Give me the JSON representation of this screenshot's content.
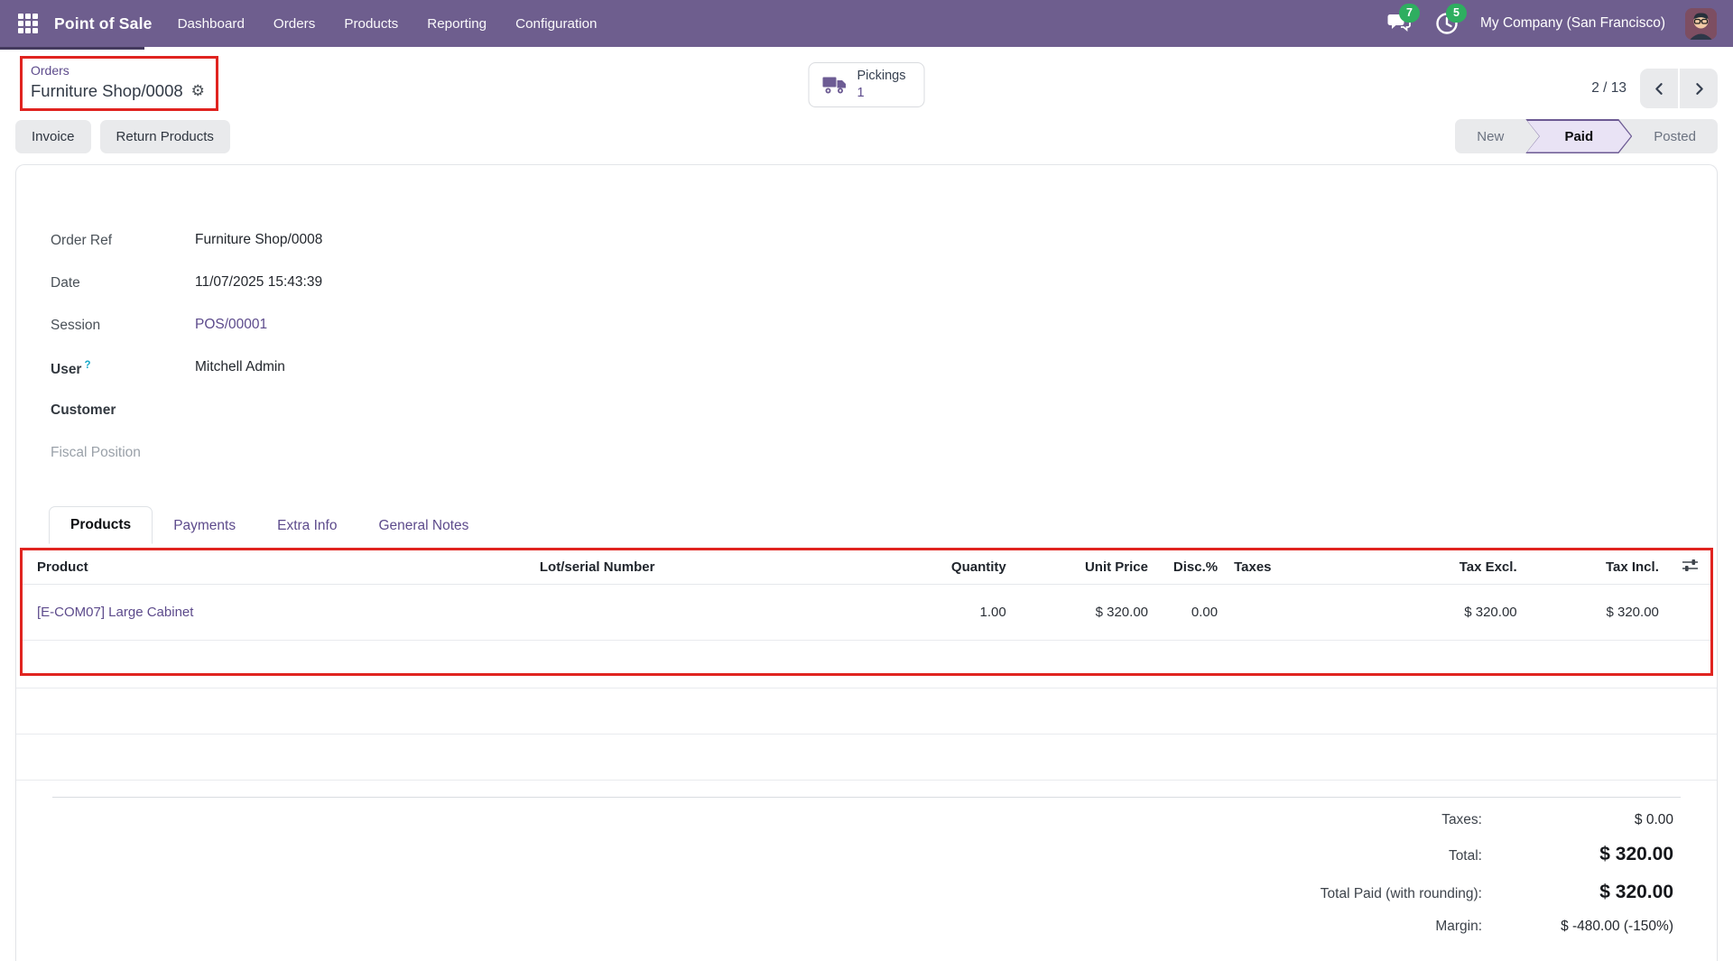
{
  "colors": {
    "navbar": "#6e5e8e",
    "accent": "#5d4b8c",
    "badge": "#2eae60",
    "annotation": "#e02420",
    "paid_bg": "#e9e3f5"
  },
  "navbar": {
    "app_name": "Point of Sale",
    "menu_items": [
      "Dashboard",
      "Orders",
      "Products",
      "Reporting",
      "Configuration"
    ],
    "messages_count": "7",
    "activities_count": "5",
    "company": "My Company (San Francisco)"
  },
  "breadcrumb": {
    "parent": "Orders",
    "current": "Furniture Shop/0008"
  },
  "pickings": {
    "label": "Pickings",
    "count": "1"
  },
  "pager": {
    "value": "2 / 13"
  },
  "buttons": {
    "invoice": "Invoice",
    "return_products": "Return Products"
  },
  "statusbar": {
    "steps": [
      {
        "label": "New",
        "active": false
      },
      {
        "label": "Paid",
        "active": true
      },
      {
        "label": "Posted",
        "active": false
      }
    ]
  },
  "fields": {
    "order_ref": {
      "label": "Order Ref",
      "value": "Furniture Shop/0008"
    },
    "date": {
      "label": "Date",
      "value": "11/07/2025 15:43:39"
    },
    "session": {
      "label": "Session",
      "value": "POS/00001"
    },
    "user": {
      "label": "User",
      "help": "?",
      "value": "Mitchell Admin"
    },
    "customer": {
      "label": "Customer",
      "value": ""
    },
    "fiscal_position": {
      "label": "Fiscal Position",
      "value": ""
    }
  },
  "tabs": [
    "Products",
    "Payments",
    "Extra Info",
    "General Notes"
  ],
  "table": {
    "columns": [
      "Product",
      "Lot/serial Number",
      "Quantity",
      "Unit Price",
      "Disc.%",
      "Taxes",
      "Tax Excl.",
      "Tax Incl."
    ],
    "row": {
      "product": "[E-COM07] Large Cabinet",
      "lot_serial": "",
      "quantity": "1.00",
      "unit_price": "$ 320.00",
      "discount": "0.00",
      "taxes": "",
      "tax_excl": "$ 320.00",
      "tax_incl": "$ 320.00"
    }
  },
  "totals": [
    {
      "label": "Taxes:",
      "value": "$ 0.00"
    },
    {
      "label": "Total:",
      "value": "$ 320.00"
    },
    {
      "label": "Total Paid (with rounding):",
      "value": "$ 320.00"
    },
    {
      "label": "Margin:",
      "value": "$ -480.00 (-150%)"
    }
  ]
}
